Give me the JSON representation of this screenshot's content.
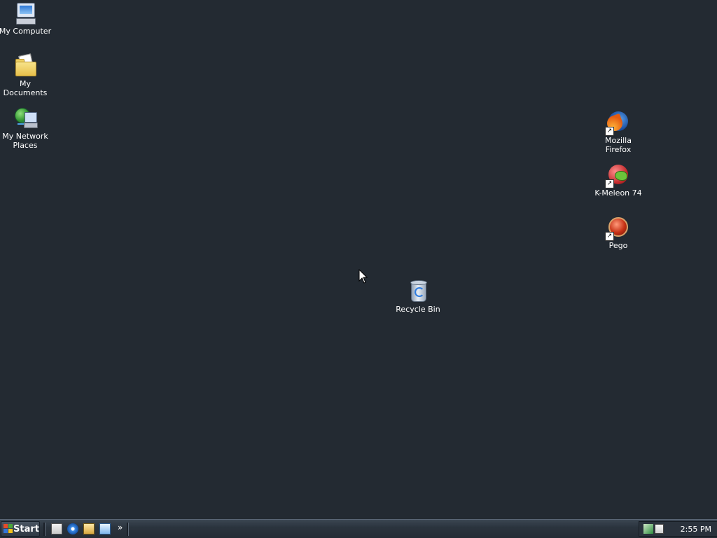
{
  "desktop": {
    "icons": [
      {
        "label": "My Computer",
        "icon": "my-computer-icon"
      },
      {
        "label": "My Documents",
        "icon": "my-documents-icon"
      },
      {
        "label": "My Network\nPlaces",
        "icon": "network-places-icon"
      },
      {
        "label": "Mozilla Firefox",
        "icon": "firefox-icon",
        "shortcut": true
      },
      {
        "label": "K-Meleon 74",
        "icon": "k-meleon-icon",
        "shortcut": true
      },
      {
        "label": "Pego",
        "icon": "pego-icon",
        "shortcut": true
      },
      {
        "label": "Recycle Bin",
        "icon": "recycle-bin-icon"
      }
    ],
    "background_color": "#232a32"
  },
  "taskbar": {
    "start_label": "Start",
    "quick_launch": [
      "show-desktop-icon",
      "internet-explorer-icon",
      "outlook-express-icon",
      "windows-explorer-icon"
    ],
    "chevron": "»",
    "clock": "2:55 PM"
  }
}
